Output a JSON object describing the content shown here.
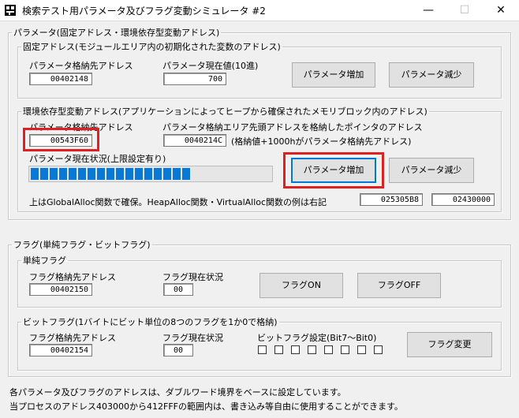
{
  "window": {
    "title": "検索テスト用パラメータ及びフラグ変動シミュレータ #2",
    "minimize": "—",
    "maximize": "☐",
    "close": "✕"
  },
  "param_group": {
    "legend": "パラメータ(固定アドレス・環境依存型変動アドレス)",
    "fixed": {
      "legend": "固定アドレス(モジュールエリア内の初期化された変数のアドレス)",
      "addr_label": "パラメータ格納先アドレス",
      "addr_value": "00402148",
      "value_label": "パラメータ現在値(10進)",
      "value": "700",
      "inc_label": "パラメータ増加",
      "dec_label": "パラメータ減少"
    },
    "dynamic": {
      "legend": "環境依存型変動アドレス(アプリケーションによってヒープから確保されたメモリブロック内のアドレス)",
      "addr_label": "パラメータ格納先アドレス",
      "addr_value": "00543F60",
      "ptr_label": "パラメータ格納エリア先頭アドレスを格納したポインタのアドレス",
      "ptr_value": "0040214C",
      "ptr_note": "(格納値+1000hがパラメータ格納先アドレス)",
      "status_label": "パラメータ現在状況(上限設定有り)",
      "progress_fraction": 0.68,
      "inc_label": "パラメータ増加",
      "dec_label": "パラメータ減少",
      "note": "上はGlobalAlloc関数で確保。HeapAlloc関数・VirtualAlloc関数の例は右記",
      "heap_value": "025305B8",
      "virtual_value": "02430000"
    }
  },
  "flag_group": {
    "legend": "フラグ(単純フラグ・ビットフラグ)",
    "simple": {
      "legend": "単純フラグ",
      "addr_label": "フラグ格納先アドレス",
      "addr_value": "00402150",
      "state_label": "フラグ現在状況",
      "state_value": "00",
      "on_label": "フラグON",
      "off_label": "フラグOFF"
    },
    "bit": {
      "legend": "ビットフラグ(1バイトにビット単位の8つのフラグを1か0で格納)",
      "addr_label": "フラグ格納先アドレス",
      "addr_value": "00402154",
      "state_label": "フラグ現在状況",
      "state_value": "00",
      "bits_label": "ビットフラグ設定(Bit7～Bit0)",
      "bits": [
        false,
        false,
        false,
        false,
        false,
        false,
        false,
        false
      ],
      "change_label": "フラグ変更"
    }
  },
  "footer": {
    "line1": "各パラメータ及びフラグのアドレスは、ダブルワード境界をベースに設定しています。",
    "line2": "当プロセスのアドレス403000から412FFFの範囲内は、書き込み等自由に使用することができます。"
  },
  "colors": {
    "progress": "#0a78d7",
    "highlight": "#e02020",
    "focus": "#0078d7"
  }
}
